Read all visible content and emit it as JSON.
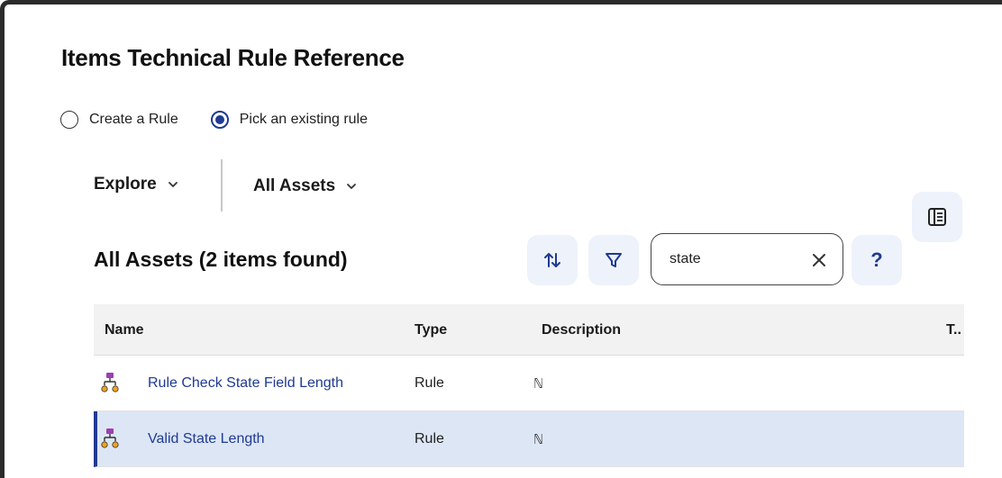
{
  "dialog": {
    "title": "Items Technical Rule Reference"
  },
  "rule_mode": {
    "options": [
      {
        "label": "Create a Rule",
        "selected": false
      },
      {
        "label": "Pick an existing rule",
        "selected": true
      }
    ]
  },
  "navigation": {
    "explore_label": "Explore",
    "scope_label": "All Assets"
  },
  "results": {
    "heading": "All Assets (2 items found)"
  },
  "search": {
    "value": "state"
  },
  "help": {
    "label": "?"
  },
  "table": {
    "columns": [
      "Name",
      "Type",
      "Description",
      "T.."
    ],
    "rows": [
      {
        "name": "Rule Check State Field Length",
        "type": "Rule",
        "description": "ℕ",
        "selected": false
      },
      {
        "name": "Valid State Length",
        "type": "Rule",
        "description": "ℕ",
        "selected": true
      }
    ]
  },
  "icons": {
    "asset": "rule-hierarchy-icon",
    "sort": "sort-arrows-icon",
    "filter": "filter-funnel-icon",
    "clear": "close-icon",
    "panel": "panel-layout-icon",
    "chevron": "chevron-down-icon"
  },
  "colors": {
    "accent": "#1f3a93",
    "selected_row": "#dde6f5",
    "button_bg": "#eef2fb",
    "icon_purple": "#9b3fb5",
    "icon_orange": "#f0a21b"
  }
}
